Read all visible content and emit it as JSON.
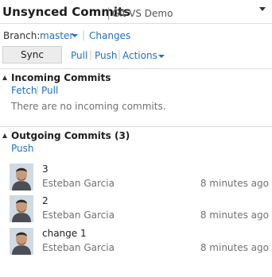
{
  "header": {
    "title": "Unsynced Commits",
    "separator": "|",
    "repo": "Git VS Demo"
  },
  "branch": {
    "label": "Branch:",
    "value": "master",
    "separator": "|",
    "changes_label": "Changes"
  },
  "toolbar": {
    "sync_label": "Sync",
    "pull_label": "Pull",
    "push_label": "Push",
    "actions_label": "Actions",
    "separator": "|"
  },
  "incoming": {
    "title": "Incoming Commits",
    "fetch_label": "Fetch",
    "pull_label": "Pull",
    "separator": "|",
    "empty_text": "There are no incoming commits."
  },
  "outgoing": {
    "title": "Outgoing Commits (3)",
    "push_label": "Push",
    "commits": [
      {
        "message": "3",
        "author": "Esteban Garcia",
        "time": "8 minutes ago"
      },
      {
        "message": "2",
        "author": "Esteban Garcia",
        "time": "8 minutes ago"
      },
      {
        "message": "change 1",
        "author": "Esteban Garcia",
        "time": "8 minutes ago"
      }
    ]
  },
  "colors": {
    "link": "#1e6fc8",
    "muted": "#717171"
  }
}
